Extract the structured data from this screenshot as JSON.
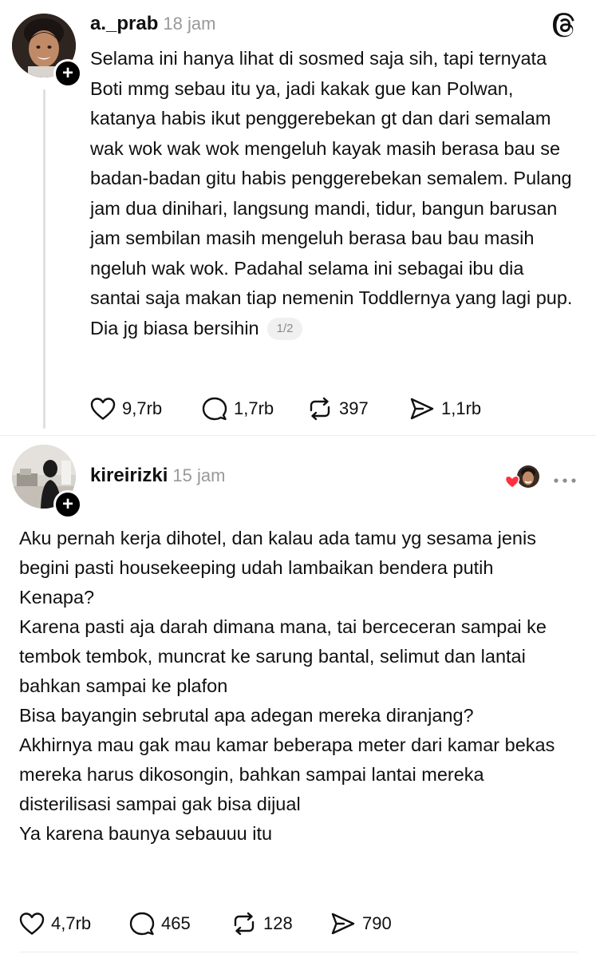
{
  "post1": {
    "username": "a._prab",
    "time": "18 jam",
    "text": "Selama ini hanya lihat di sosmed saja sih, tapi ternyata Boti mmg sebau itu ya, jadi kakak gue kan Polwan, katanya habis ikut penggerebekan gt dan dari semalam wak wok wak wok mengeluh kayak masih berasa bau se badan-badan gitu habis penggerebekan semalem. Pulang jam dua dinihari, langsung mandi, tidur, bangun barusan jam sembilan masih mengeluh berasa bau bau masih ngeluh wak wok. Padahal selama ini sebagai ibu dia santai saja makan tiap nemenin Toddlernya yang lagi pup. Dia jg biasa bersihin",
    "page_indicator": "1/2",
    "likes": "9,7rb",
    "replies": "1,7rb",
    "reposts": "397",
    "shares": "1,1rb"
  },
  "post2": {
    "username": "kireirizki",
    "time": "15 jam",
    "paragraphs": [
      "Aku pernah kerja dihotel, dan kalau ada tamu yg sesama jenis begini pasti housekeeping udah lambaikan bendera putih",
      "Kenapa?",
      "Karena pasti aja darah dimana mana, tai berceceran sampai ke tembok tembok, muncrat ke sarung bantal, selimut dan lantai bahkan sampai ke plafon",
      "Bisa bayangin sebrutal apa adegan mereka diranjang?",
      "Akhirnya mau gak mau kamar beberapa meter dari kamar bekas mereka harus dikosongin, bahkan sampai lantai mereka disterilisasi sampai gak bisa dijual",
      "Ya karena baunya sebauuu itu"
    ],
    "likes": "4,7rb",
    "replies": "465",
    "reposts": "128",
    "shares": "790"
  },
  "colors": {
    "text": "#101010",
    "muted": "#999999",
    "heart": "#ff3040",
    "divider": "#e6e6e6"
  },
  "icons": [
    "threads-logo-icon",
    "heart-icon",
    "comment-icon",
    "repost-icon",
    "share-icon",
    "more-icon",
    "liked-by-author-icon"
  ]
}
